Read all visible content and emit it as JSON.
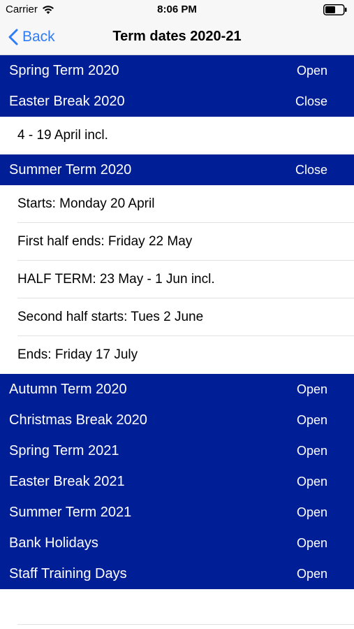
{
  "status_bar": {
    "carrier": "Carrier",
    "time": "8:06 PM"
  },
  "nav": {
    "back_label": "Back",
    "title": "Term dates 2020-21"
  },
  "colors": {
    "header_bg": "#001e96",
    "accent": "#2f7cf6"
  },
  "sections": [
    {
      "title": "Spring Term 2020",
      "toggle": "Open"
    },
    {
      "title": "Easter Break 2020",
      "toggle": "Close",
      "rows": [
        "4 - 19 April incl."
      ]
    },
    {
      "title": "Summer Term 2020",
      "toggle": "Close",
      "rows": [
        "Starts: Monday 20 April",
        "First half ends: Friday 22 May",
        "HALF TERM: 23 May - 1 Jun incl.",
        "Second half starts: Tues 2 June",
        "Ends: Friday 17 July"
      ]
    },
    {
      "title": "Autumn Term 2020",
      "toggle": "Open"
    },
    {
      "title": "Christmas Break 2020",
      "toggle": "Open"
    },
    {
      "title": "Spring Term 2021",
      "toggle": "Open"
    },
    {
      "title": "Easter Break 2021",
      "toggle": "Open"
    },
    {
      "title": "Summer Term 2021",
      "toggle": "Open"
    },
    {
      "title": "Bank Holidays",
      "toggle": "Open"
    },
    {
      "title": "Staff Training Days",
      "toggle": "Open"
    }
  ]
}
